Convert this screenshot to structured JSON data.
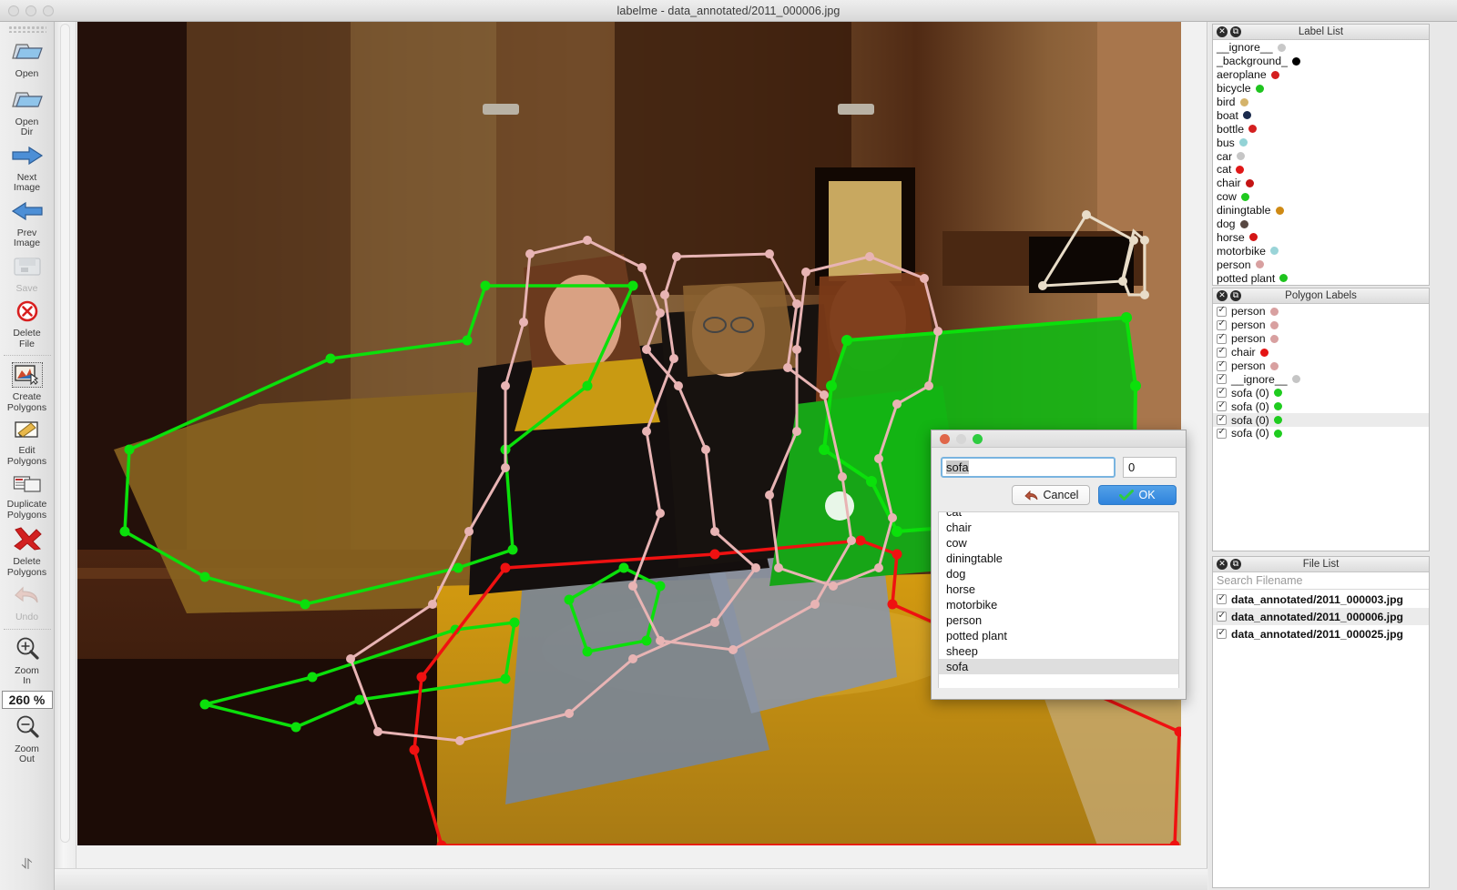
{
  "window": {
    "title": "labelme - data_annotated/2011_000006.jpg",
    "lights": [
      "minimize-disabled",
      "zoom-disabled",
      "close-disabled"
    ]
  },
  "toolbar": {
    "items": [
      {
        "label": "Open",
        "icon": "open-folder-icon",
        "enabled": true,
        "active": false
      },
      {
        "label": "Open\nDir",
        "icon": "open-dir-icon",
        "enabled": true,
        "active": false
      },
      {
        "label": "Next\nImage",
        "icon": "next-arrow-icon",
        "enabled": true,
        "active": false
      },
      {
        "label": "Prev\nImage",
        "icon": "prev-arrow-icon",
        "enabled": true,
        "active": false
      },
      {
        "label": "Save",
        "icon": "save-icon",
        "enabled": false,
        "active": false
      },
      {
        "label": "Delete\nFile",
        "icon": "delete-file-icon",
        "enabled": true,
        "active": false
      },
      {
        "label": "Create\nPolygons",
        "icon": "create-polygons-icon",
        "enabled": true,
        "active": true
      },
      {
        "label": "Edit\nPolygons",
        "icon": "edit-polygons-icon",
        "enabled": true,
        "active": false
      },
      {
        "label": "Duplicate\nPolygons",
        "icon": "duplicate-polygons-icon",
        "enabled": true,
        "active": false
      },
      {
        "label": "Delete\nPolygons",
        "icon": "delete-polygons-icon",
        "enabled": true,
        "active": false
      },
      {
        "label": "Undo",
        "icon": "undo-icon",
        "enabled": false,
        "active": false
      },
      {
        "label": "Zoom\nIn",
        "icon": "zoom-in-icon",
        "enabled": true,
        "active": false
      },
      {
        "label": "Zoom\nOut",
        "icon": "zoom-out-icon",
        "enabled": true,
        "active": false
      }
    ],
    "zoom_value": "260 %",
    "overflow_icon": "chevron-double-down-icon"
  },
  "label_list": {
    "title": "Label List",
    "close_icon": "close-icon",
    "float_icon": "undock-icon",
    "items": [
      {
        "label": "__ignore__",
        "color": "#c8c8c8"
      },
      {
        "label": "_background_",
        "color": "#000000"
      },
      {
        "label": "aeroplane",
        "color": "#d41f1f"
      },
      {
        "label": "bicycle",
        "color": "#1fc41f"
      },
      {
        "label": "bird",
        "color": "#d4b36a"
      },
      {
        "label": "boat",
        "color": "#1b2b4d"
      },
      {
        "label": "bottle",
        "color": "#d42020"
      },
      {
        "label": "bus",
        "color": "#93d3d6"
      },
      {
        "label": "car",
        "color": "#c6c6c6"
      },
      {
        "label": "cat",
        "color": "#e01717"
      },
      {
        "label": "chair",
        "color": "#c41414"
      },
      {
        "label": "cow",
        "color": "#1fc91f"
      },
      {
        "label": "diningtable",
        "color": "#cf8a14"
      },
      {
        "label": "dog",
        "color": "#574741"
      },
      {
        "label": "horse",
        "color": "#d41616"
      },
      {
        "label": "motorbike",
        "color": "#9ad4d8"
      },
      {
        "label": "person",
        "color": "#d8a0a0"
      },
      {
        "label": "potted plant",
        "color": "#1fc41f"
      }
    ]
  },
  "polygon_labels": {
    "title": "Polygon Labels",
    "close_icon": "close-icon",
    "float_icon": "undock-icon",
    "items": [
      {
        "label": "person",
        "color": "#d8a0a0",
        "checked": true,
        "selected": false
      },
      {
        "label": "person",
        "color": "#d8a0a0",
        "checked": true,
        "selected": false
      },
      {
        "label": "person",
        "color": "#d8a0a0",
        "checked": true,
        "selected": false
      },
      {
        "label": "chair",
        "color": "#e41414",
        "checked": true,
        "selected": false
      },
      {
        "label": "person",
        "color": "#d8a0a0",
        "checked": true,
        "selected": false
      },
      {
        "label": "__ignore__",
        "color": "#c5c5c5",
        "checked": true,
        "selected": false
      },
      {
        "label": "sofa (0)",
        "color": "#1fcc1f",
        "checked": true,
        "selected": false
      },
      {
        "label": "sofa (0)",
        "color": "#1fcc1f",
        "checked": true,
        "selected": false
      },
      {
        "label": "sofa (0)",
        "color": "#1fcc1f",
        "checked": true,
        "selected": true
      },
      {
        "label": "sofa (0)",
        "color": "#1fcc1f",
        "checked": true,
        "selected": false
      }
    ]
  },
  "file_list": {
    "title": "File List",
    "close_icon": "close-icon",
    "float_icon": "undock-icon",
    "search_placeholder": "Search Filename",
    "search_value": "",
    "items": [
      {
        "name": "data_annotated/2011_000003.jpg",
        "checked": true,
        "selected": false
      },
      {
        "name": "data_annotated/2011_000006.jpg",
        "checked": true,
        "selected": true
      },
      {
        "name": "data_annotated/2011_000025.jpg",
        "checked": true,
        "selected": false
      }
    ]
  },
  "dialog": {
    "lights": {
      "close": "#e0674a",
      "minimize": "#d6d6d6",
      "zoom": "#2ecc40"
    },
    "label_value": "sofa",
    "group_id_value": "0",
    "cancel_label": "Cancel",
    "cancel_icon": "undo-arrow-icon",
    "ok_label": "OK",
    "ok_icon": "check-icon",
    "options": [
      {
        "label": "cat",
        "selected": false
      },
      {
        "label": "chair",
        "selected": false
      },
      {
        "label": "cow",
        "selected": false
      },
      {
        "label": "diningtable",
        "selected": false
      },
      {
        "label": "dog",
        "selected": false
      },
      {
        "label": "horse",
        "selected": false
      },
      {
        "label": "motorbike",
        "selected": false
      },
      {
        "label": "person",
        "selected": false
      },
      {
        "label": "potted plant",
        "selected": false
      },
      {
        "label": "sheep",
        "selected": false
      },
      {
        "label": "sofa",
        "selected": true
      }
    ]
  },
  "canvas": {
    "image_description": "Photograph of three women sitting on a gold sofa in a dim room with wooden cabinets",
    "shape_colors": {
      "person": "#e8b4b4",
      "sofa_selected_fill": "#17b317",
      "sofa_outline": "#0fe00f",
      "chair": "#ee1111",
      "ignore": "#e8dcc8"
    }
  }
}
